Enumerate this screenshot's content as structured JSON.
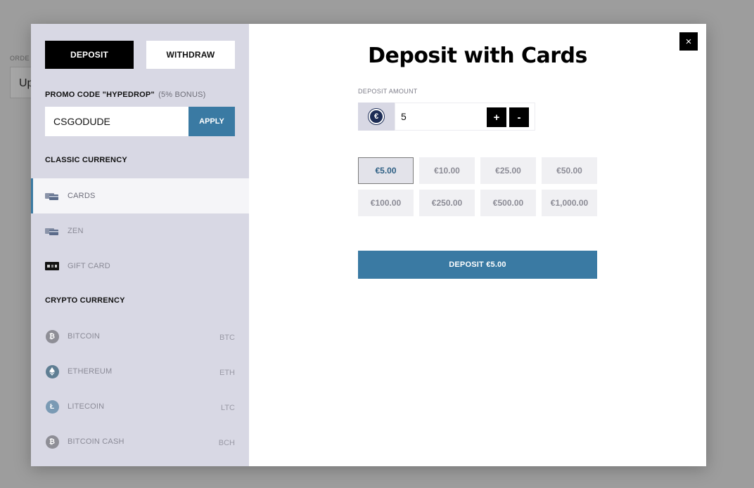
{
  "background": {
    "label": "ORDE",
    "box_text": "Up"
  },
  "tabs": [
    {
      "label": "DEPOSIT",
      "active": true
    },
    {
      "label": "WITHDRAW",
      "active": false
    }
  ],
  "promo": {
    "label": "PROMO CODE \"HYPEDROP\"",
    "bonus": "(5% BONUS)",
    "value": "CSGODUDE",
    "apply_label": "APPLY"
  },
  "classic_title": "CLASSIC CURRENCY",
  "classic_methods": [
    {
      "label": "CARDS",
      "icon": "card-icon",
      "active": true
    },
    {
      "label": "ZEN",
      "icon": "card-icon",
      "active": false
    },
    {
      "label": "GIFT CARD",
      "icon": "gift-card-icon",
      "active": false
    }
  ],
  "crypto_title": "CRYPTO CURRENCY",
  "crypto_methods": [
    {
      "label": "BITCOIN",
      "code": "BTC",
      "icon": "bitcoin-icon",
      "color": "#8e8e96"
    },
    {
      "label": "ETHEREUM",
      "code": "ETH",
      "icon": "ethereum-icon",
      "color": "#5f7e93"
    },
    {
      "label": "LITECOIN",
      "code": "LTC",
      "icon": "litecoin-icon",
      "color": "#7a9ab4"
    },
    {
      "label": "BITCOIN CASH",
      "code": "BCH",
      "icon": "bitcoin-cash-icon",
      "color": "#8e8e96"
    }
  ],
  "main": {
    "title": "Deposit with Cards",
    "close_label": "×",
    "amount_label": "DEPOSIT AMOUNT",
    "currency_symbol": "€",
    "amount_value": "5",
    "plus_label": "+",
    "minus_label": "-",
    "presets": [
      "€5.00",
      "€10.00",
      "€25.00",
      "€50.00",
      "€100.00",
      "€250.00",
      "€500.00",
      "€1,000.00"
    ],
    "selected_preset": "€5.00",
    "deposit_label": "DEPOSIT €5.00"
  },
  "colors": {
    "accent": "#3a7aa3",
    "sidebar_bg": "#d8d8e4"
  }
}
